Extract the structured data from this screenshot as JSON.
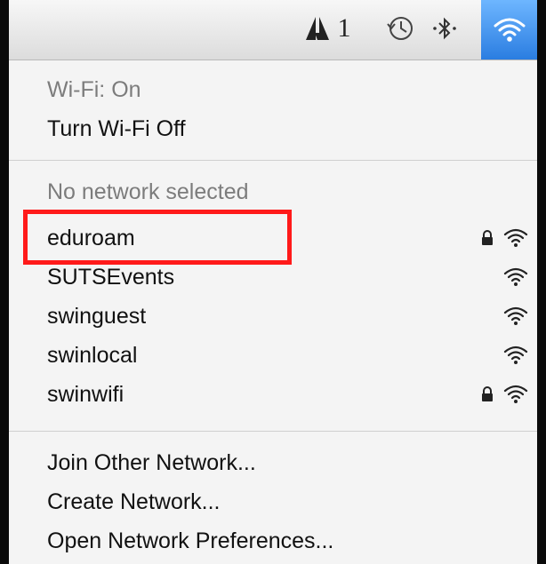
{
  "menubar": {
    "icons": [
      "adobe-icon",
      "timemachine-icon",
      "bluetooth-icon",
      "wifi-icon"
    ],
    "adobe_count": "1"
  },
  "menu": {
    "status": "Wi-Fi: On",
    "toggle_label": "Turn Wi-Fi Off",
    "network_status": "No network selected",
    "networks": [
      {
        "name": "eduroam",
        "locked": true
      },
      {
        "name": "SUTSEvents",
        "locked": false
      },
      {
        "name": "swinguest",
        "locked": false
      },
      {
        "name": "swinlocal",
        "locked": false
      },
      {
        "name": "swinwifi",
        "locked": true
      }
    ],
    "actions": [
      "Join Other Network...",
      "Create Network...",
      "Open Network Preferences..."
    ]
  },
  "colors": {
    "wifi_active_bg": "#2a7de1",
    "highlight": "#ff1a1a"
  }
}
